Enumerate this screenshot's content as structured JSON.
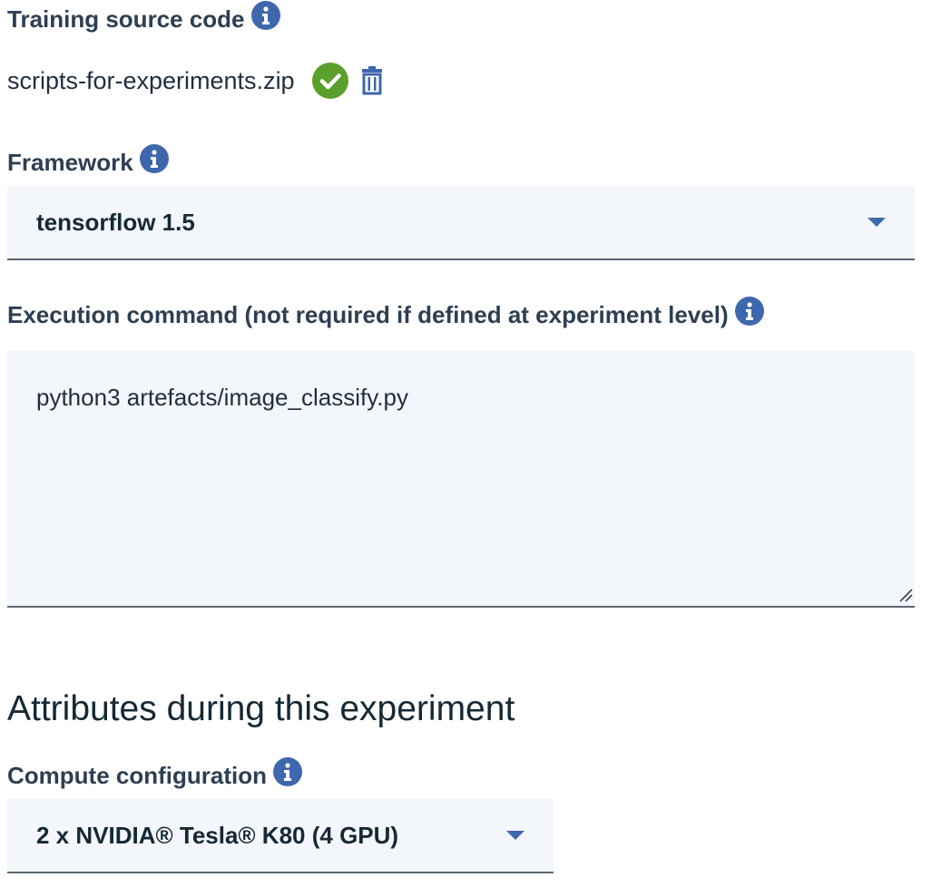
{
  "training_source": {
    "label": "Training source code",
    "info_icon": "info-icon",
    "file_name": "scripts-for-experiments.zip",
    "status_icon": "check-circle-icon",
    "delete_icon": "trash-icon"
  },
  "framework": {
    "label": "Framework",
    "info_icon": "info-icon",
    "selected": "tensorflow 1.5",
    "caret_icon": "chevron-down-icon"
  },
  "execution_command": {
    "label": "Execution command (not required if defined at experiment level)",
    "info_icon": "info-icon",
    "value": "python3 artefacts/image_classify.py"
  },
  "attributes_section": {
    "heading": "Attributes during this experiment"
  },
  "compute_configuration": {
    "label": "Compute configuration",
    "info_icon": "info-icon",
    "selected": "2 x NVIDIA® Tesla® K80 (4 GPU)",
    "caret_icon": "chevron-down-icon"
  },
  "colors": {
    "accent_blue": "#3f67ad",
    "success_green": "#5aa02c",
    "field_background": "#f3f6fb",
    "field_border": "#5a6872",
    "label_text": "#2d3f52"
  }
}
